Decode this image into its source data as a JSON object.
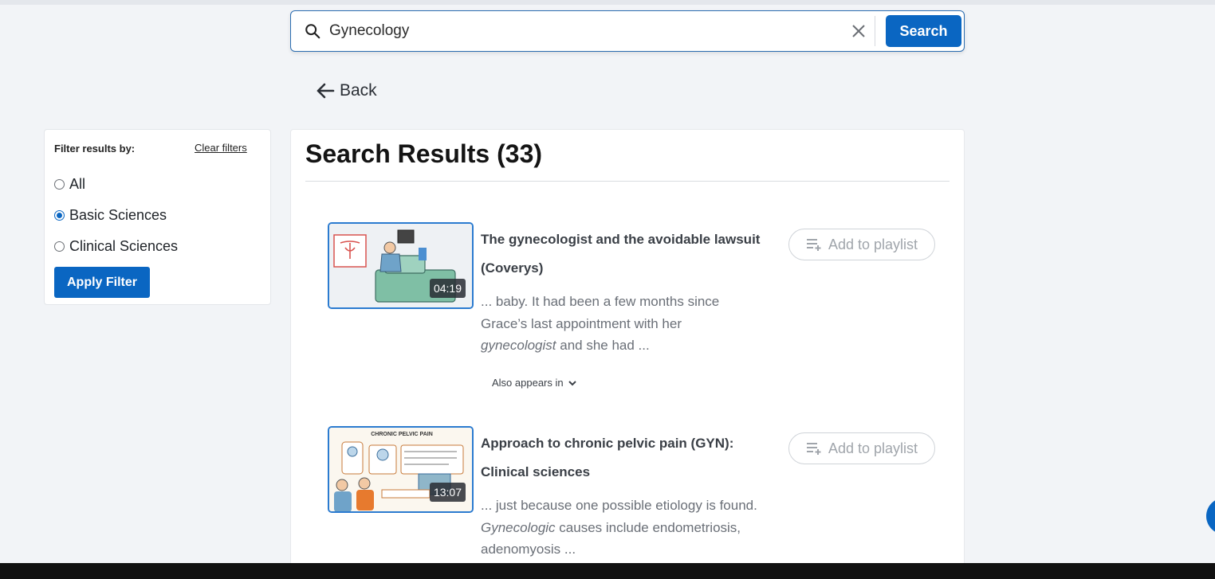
{
  "search": {
    "query": "Gynecology",
    "button_label": "Search"
  },
  "nav": {
    "back_label": "Back"
  },
  "filter": {
    "title": "Filter results by:",
    "clear_label": "Clear filters",
    "options": [
      {
        "label": "All",
        "checked": false
      },
      {
        "label": "Basic Sciences",
        "checked": true
      },
      {
        "label": "Clinical Sciences",
        "checked": false
      }
    ],
    "apply_label": "Apply Filter"
  },
  "results": {
    "heading": "Search Results (33)",
    "items": [
      {
        "title": "The gynecologist and the avoidable lawsuit (Coverys)",
        "duration": "04:19",
        "snippet_lines": [
          "... baby. It had been a few months since",
          "Grace’s last appointment with her"
        ],
        "snippet_em": "gynecologist",
        "snippet_tail": " and she had ...",
        "playlist_label": "Add to playlist",
        "also_label": "Also appears in"
      },
      {
        "title": "Approach to chronic pelvic pain (GYN): Clinical sciences",
        "duration": "13:07",
        "snippet_lines": [
          "... just because one possible etiology is found."
        ],
        "snippet_em": "Gynecologic",
        "snippet_tail": " causes include endometriosis,",
        "snippet_last": "adenomyosis ...",
        "playlist_label": "Add to playlist",
        "thumb_heading": "CHRONIC PELVIC PAIN"
      }
    ]
  },
  "colors": {
    "accent": "#0a66c2",
    "background": "#f2f4f7"
  },
  "icons": [
    "search-icon",
    "close-icon",
    "arrow-left-icon",
    "playlist-add-icon",
    "chevron-down-icon"
  ]
}
